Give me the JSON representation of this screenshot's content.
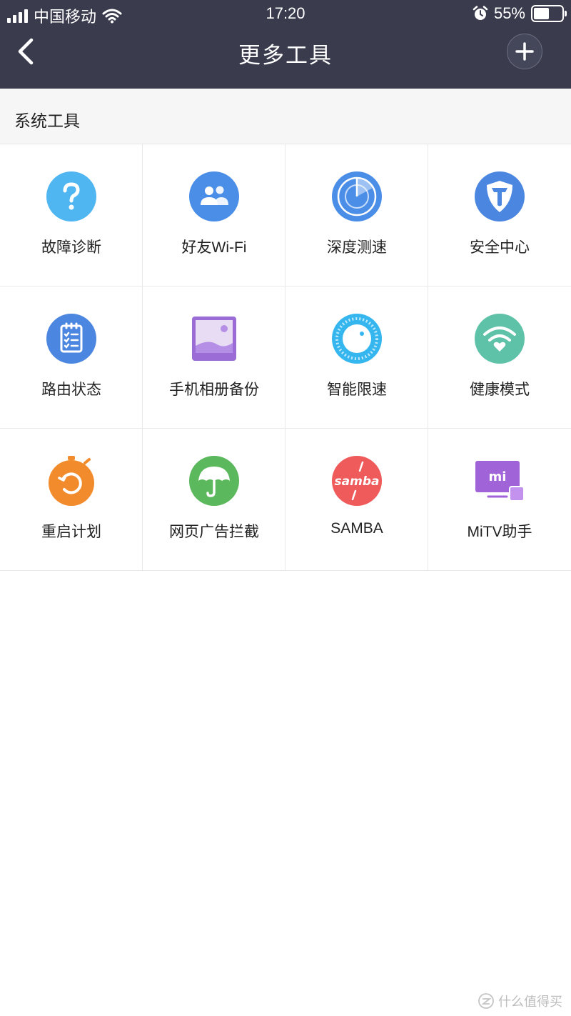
{
  "status_bar": {
    "carrier": "中国移动",
    "time": "17:20",
    "battery_percent": "55%",
    "battery_level": 0.55,
    "icons": [
      "signal-icon",
      "wifi-icon",
      "alarm-icon",
      "battery-icon"
    ]
  },
  "nav": {
    "title": "更多工具",
    "back_icon": "chevron-left-icon",
    "add_icon": "plus-icon"
  },
  "section": {
    "title": "系统工具"
  },
  "tools": [
    {
      "label": "故障诊断",
      "icon": "question-icon",
      "color": "#4fb6f2"
    },
    {
      "label": "好友Wi-Fi",
      "icon": "users-icon",
      "color": "#4b8ee8"
    },
    {
      "label": "深度测速",
      "icon": "radar-icon",
      "color": "#4b8ee8"
    },
    {
      "label": "安全中心",
      "icon": "shield-icon",
      "color": "#4b86e0"
    },
    {
      "label": "路由状态",
      "icon": "clipboard-icon",
      "color": "#4b86e0"
    },
    {
      "label": "手机相册备份",
      "icon": "photo-icon",
      "color": "#9b6cd6"
    },
    {
      "label": "智能限速",
      "icon": "speed-dial-icon",
      "color": "#36b6ef"
    },
    {
      "label": "健康模式",
      "icon": "wifi-heart-icon",
      "color": "#5ec2a8"
    },
    {
      "label": "重启计划",
      "icon": "timer-icon",
      "color": "#f28b2c"
    },
    {
      "label": "网页广告拦截",
      "icon": "umbrella-icon",
      "color": "#5cb85c"
    },
    {
      "label": "SAMBA",
      "icon": "samba-icon",
      "color": "#ef5b5b",
      "icon_text": "samba"
    },
    {
      "label": "MiTV助手",
      "icon": "tv-icon",
      "color": "#a063d8",
      "icon_text": "mi"
    }
  ],
  "watermark": {
    "text": "什么值得买",
    "icon": "zhi-logo-icon"
  }
}
